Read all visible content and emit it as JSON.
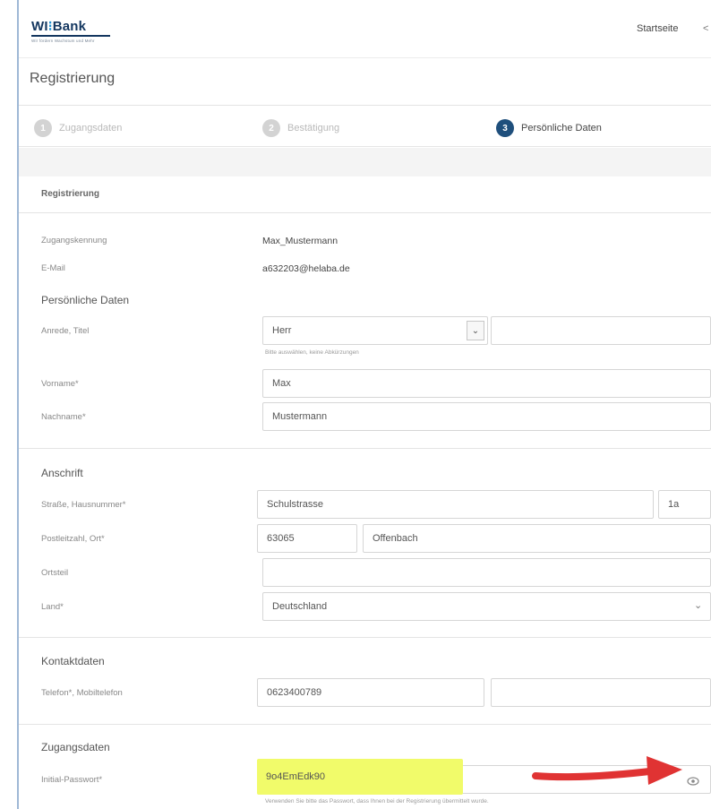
{
  "header": {
    "logo_text_a": "WI",
    "logo_text_e": "⁝",
    "logo_text_b": "Bank",
    "logo_tagline": "Wir fördern Wachstum und Mehr",
    "link": "Startseite",
    "share_icon": "share-icon",
    "page_title": "Registrierung"
  },
  "stepper": [
    {
      "number": "1",
      "label": "Zugangsdaten",
      "active": false
    },
    {
      "number": "2",
      "label": "Bestätigung",
      "active": false
    },
    {
      "number": "3",
      "label": "Persönliche Daten",
      "active": true
    }
  ],
  "form": {
    "section_title": "Registrierung",
    "username_label": "Zugangskennung",
    "username_value": "Max_Mustermann",
    "email_label": "E-Mail",
    "email_value": "a632203@helaba.de",
    "personal_title": "Persönliche Daten",
    "salutation_label": "Anrede, Titel",
    "salutation_value": "Herr",
    "title_value": "",
    "salutation_hint": "Bitte auswählen, keine Abkürzungen",
    "firstname_label": "Vorname*",
    "firstname_value": "Max",
    "lastname_label": "Nachname*",
    "lastname_value": "Mustermann",
    "address_title": "Anschrift",
    "street_label": "Straße, Hausnummer*",
    "street_value": "Schulstrasse",
    "housenumber_value": "1a",
    "zip_city_label": "Postleitzahl, Ort*",
    "zip_value": "63065",
    "city_value": "Offenbach",
    "district_label": "Ortsteil",
    "district_value": "",
    "country_label": "Land*",
    "country_value": "Deutschland",
    "contact_title": "Kontaktdaten",
    "phone_label": "Telefon*, Mobiltelefon",
    "phone_value": "0623400789",
    "mobile_value": "",
    "access_title": "Zugangsdaten",
    "password_label": "Initial-Passwort*",
    "password_value": "9o4EmEdk90",
    "password_hint": "Verwenden Sie bitte das Passwort, dass Ihnen bei der Registrierung übermittelt wurde."
  },
  "icons": {
    "select_chevron": "chevron-down-icon",
    "password_toggle": "eye-icon",
    "annotation": "red-arrow"
  },
  "colors": {
    "brand": "#13365f",
    "active_step": "#1f4f7c",
    "highlight": "#f1fb6a",
    "arrow": "#e03333"
  }
}
